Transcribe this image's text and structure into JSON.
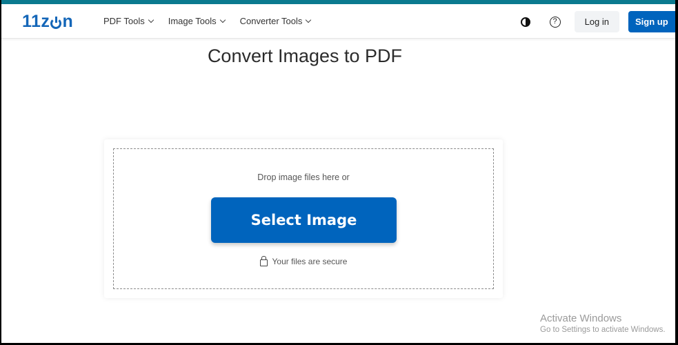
{
  "brand": {
    "logo_text_pre": "11z",
    "logo_text_post": "n",
    "accent_color": "#0064bd",
    "top_strip_color": "#0b7a8f"
  },
  "nav": {
    "items": [
      {
        "label": "PDF Tools"
      },
      {
        "label": "Image Tools"
      },
      {
        "label": "Converter Tools"
      }
    ],
    "theme_toggle_icon": "contrast-icon",
    "help_icon_glyph": "?",
    "login_label": "Log in",
    "signup_label": "Sign up"
  },
  "main": {
    "title": "Convert Images to PDF",
    "dropzone": {
      "hint": "Drop image files here or",
      "button_label": "Select Image",
      "secure_text": "Your files are secure",
      "secure_icon": "lock-icon"
    }
  },
  "watermark": {
    "line1": "Activate Windows",
    "line2": "Go to Settings to activate Windows."
  }
}
